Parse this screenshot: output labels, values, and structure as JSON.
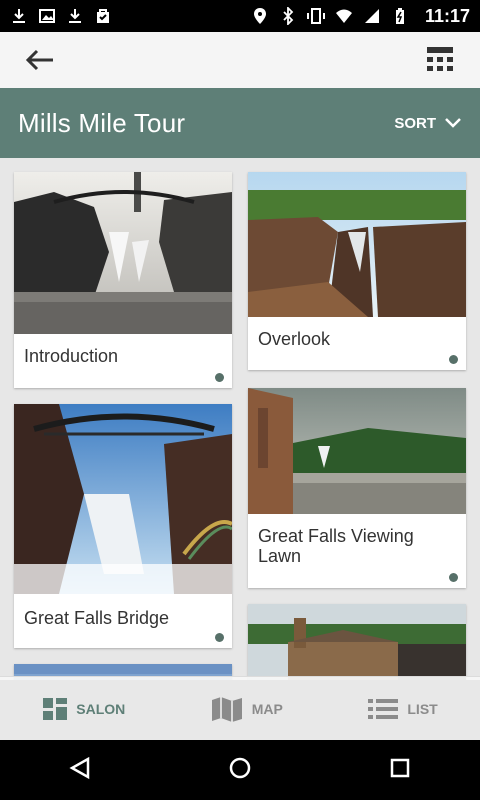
{
  "status_bar": {
    "time": "11:17"
  },
  "title_bar": {
    "title": "Mills Mile Tour",
    "sort_label": "SORT"
  },
  "cards": [
    {
      "label": "Introduction"
    },
    {
      "label": "Overlook"
    },
    {
      "label": "Great Falls Bridge"
    },
    {
      "label": "Great Falls Viewing Lawn"
    }
  ],
  "tabs": [
    {
      "label": "SALON",
      "active": true
    },
    {
      "label": "MAP",
      "active": false
    },
    {
      "label": "LIST",
      "active": false
    }
  ],
  "colors": {
    "accent": "#5e7f77",
    "background": "#e7e7e7",
    "dot": "#577069"
  }
}
